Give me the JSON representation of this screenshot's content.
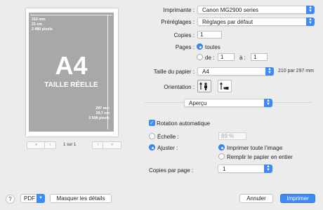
{
  "preview": {
    "dims_top": [
      "210 mm",
      "21 cm",
      "2 480 pixels"
    ],
    "dims_bottom": [
      "297 mm",
      "29,7 cm",
      "3 508 pixels"
    ],
    "big_label": "A4",
    "sub_label": "TAILLE RÉELLE",
    "page_count": "1 sur 1",
    "nav": {
      "first": "«",
      "prev": "‹",
      "next": "›",
      "last": "»"
    }
  },
  "printer": {
    "label": "Imprimante :",
    "value": "Canon MG2900 series"
  },
  "presets": {
    "label": "Préréglages :",
    "value": "Réglages par défaut"
  },
  "copies": {
    "label": "Copies :",
    "value": "1"
  },
  "pages": {
    "label": "Pages :",
    "all_label": "toutes",
    "from_label": "de :",
    "from_value": "1",
    "to_label": "à :",
    "to_value": "1",
    "selected": "all"
  },
  "paper_size": {
    "label": "Taille du papier :",
    "value": "A4",
    "dimensions": "210 par 297 mm"
  },
  "orientation": {
    "label": "Orientation :",
    "selected": "portrait"
  },
  "section": {
    "value": "Aperçu"
  },
  "auto_rotate": {
    "label": "Rotation automatique",
    "checked": true
  },
  "scale": {
    "label": "Échelle :",
    "value": "89 %"
  },
  "fit": {
    "label": "Ajuster :",
    "print_entire_label": "Imprimer toute l’image",
    "fill_paper_label": "Remplir le papier en entier",
    "selected": "print_entire"
  },
  "copies_per_page": {
    "label": "Copies par page :",
    "value": "1"
  },
  "footer": {
    "help": "?",
    "pdf": "PDF",
    "hide_details": "Masquer les détails",
    "cancel": "Annuler",
    "print": "Imprimer"
  },
  "colors": {
    "accent": "#3d8af7",
    "sheet": "#a8a8a8"
  }
}
